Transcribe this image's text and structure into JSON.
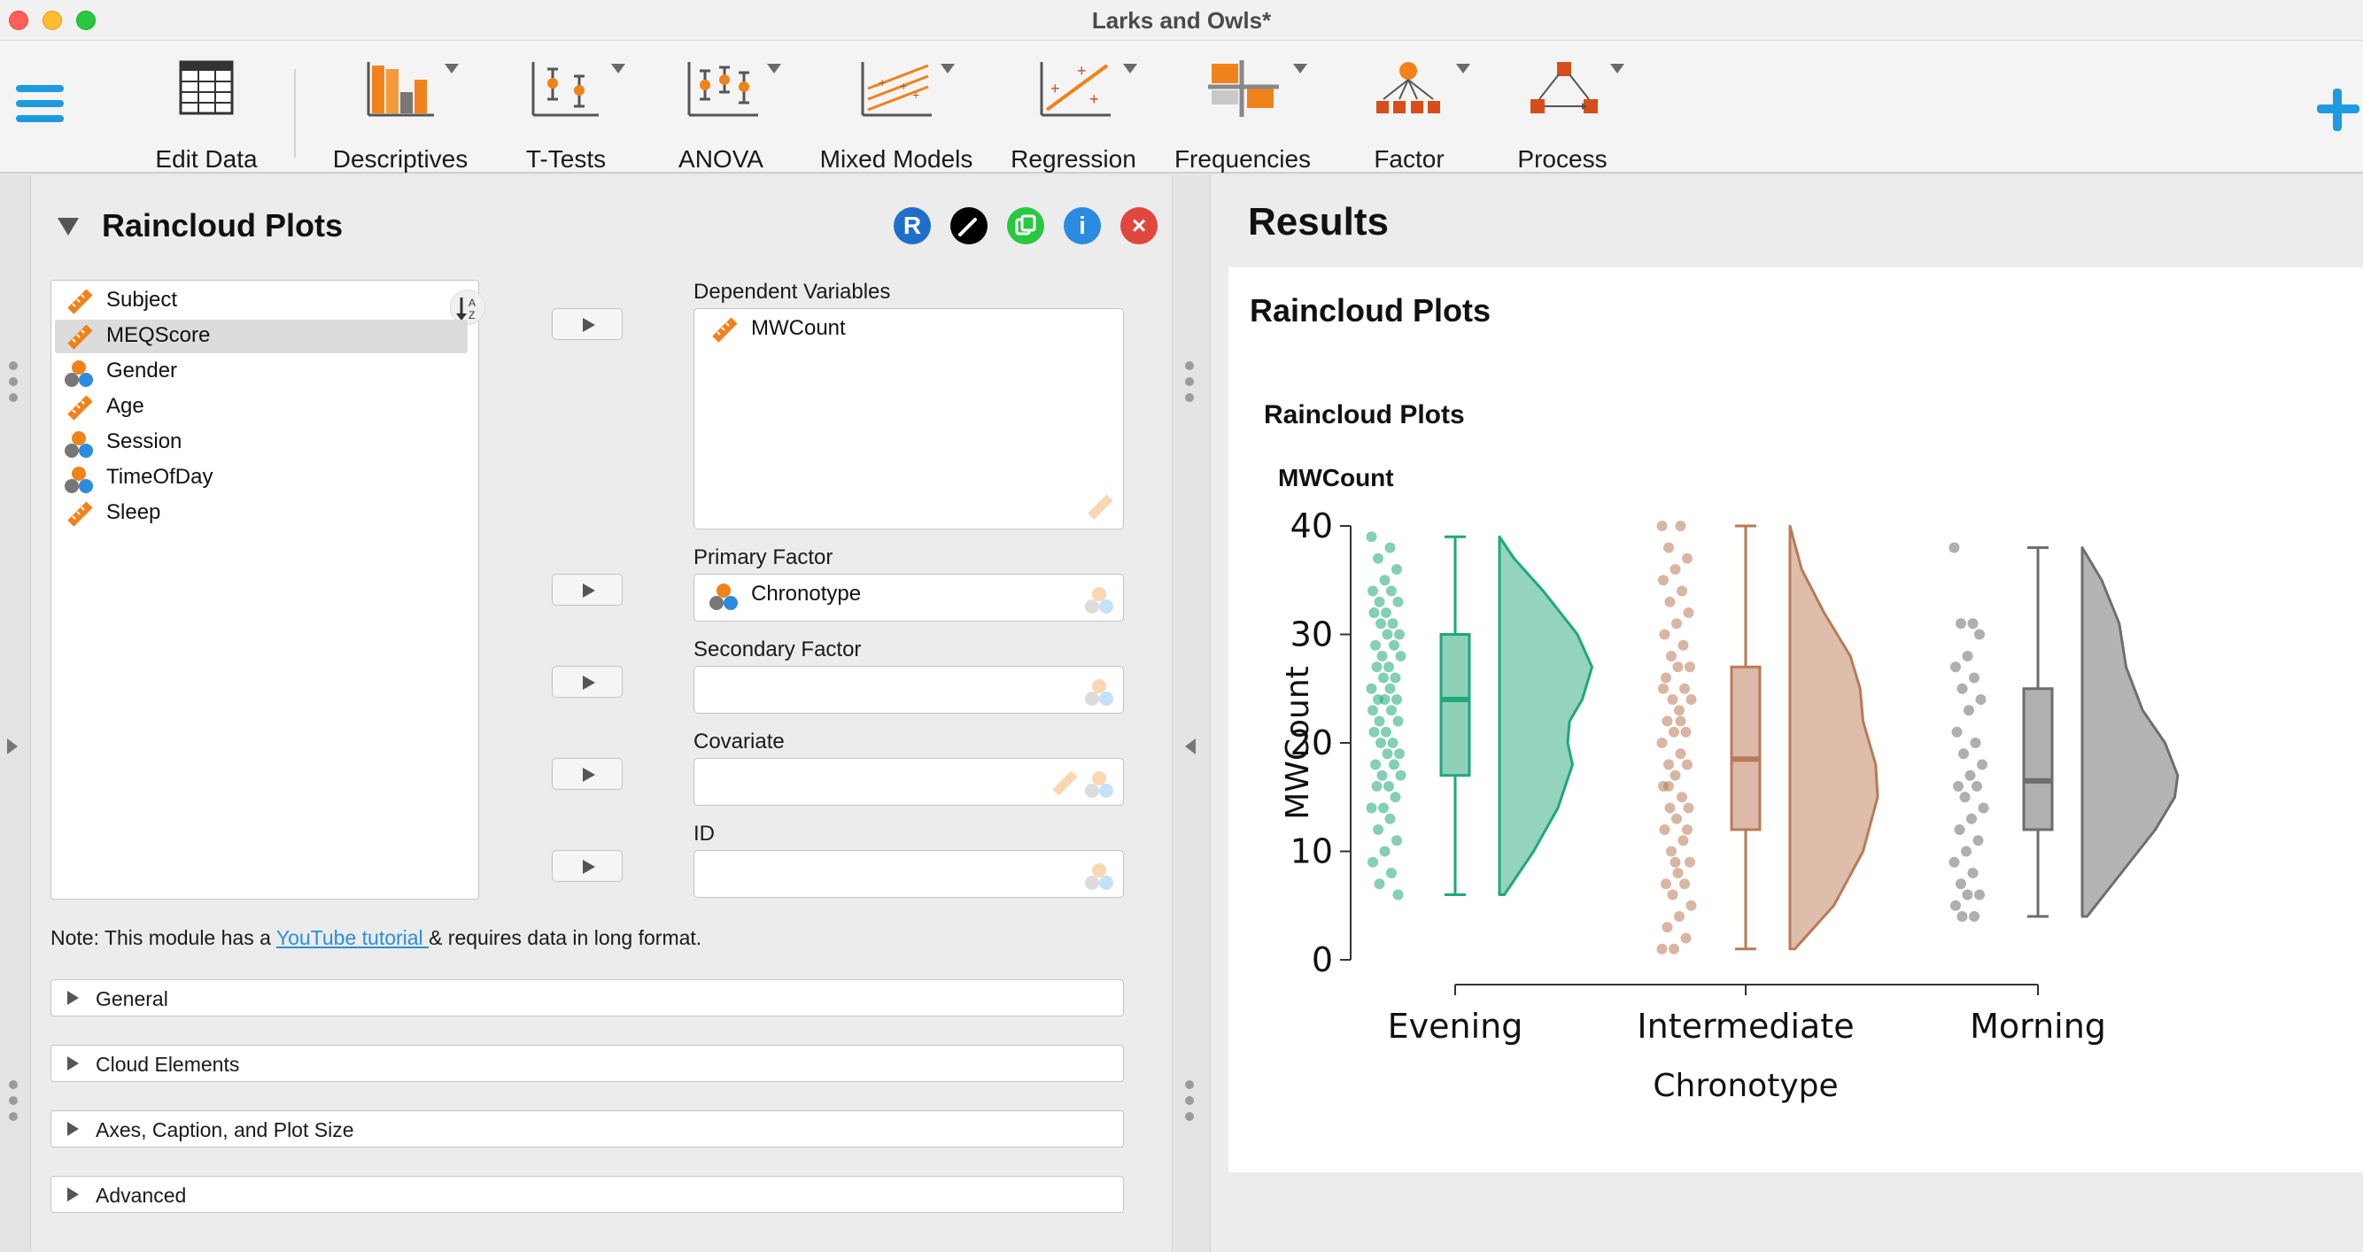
{
  "window": {
    "title": "Larks and Owls*"
  },
  "ribbon": {
    "items": [
      {
        "label": "Edit Data",
        "icon": "spreadsheet-icon",
        "menu": false
      },
      {
        "label": "Descriptives",
        "icon": "bar-chart-icon",
        "menu": true
      },
      {
        "label": "T-Tests",
        "icon": "t-test-icon",
        "menu": true
      },
      {
        "label": "ANOVA",
        "icon": "anova-icon",
        "menu": true
      },
      {
        "label": "Mixed Models",
        "icon": "mixed-models-icon",
        "menu": true
      },
      {
        "label": "Regression",
        "icon": "regression-icon",
        "menu": true
      },
      {
        "label": "Frequencies",
        "icon": "frequencies-icon",
        "menu": true
      },
      {
        "label": "Factor",
        "icon": "factor-icon",
        "menu": true
      },
      {
        "label": "Process",
        "icon": "process-icon",
        "menu": true
      }
    ]
  },
  "analysis": {
    "title": "Raincloud Plots",
    "header_icons": [
      {
        "name": "r-syntax-icon",
        "glyph": "R",
        "color": "#1f6fc9"
      },
      {
        "name": "edit-title-icon",
        "glyph": "",
        "color": "#000000"
      },
      {
        "name": "duplicate-icon",
        "glyph": "",
        "color": "#28c840"
      },
      {
        "name": "info-icon",
        "glyph": "i",
        "color": "#2a8be0"
      },
      {
        "name": "close-icon",
        "glyph": "×",
        "color": "#e0483e"
      }
    ],
    "variables": [
      {
        "name": "Subject",
        "type": "scale",
        "selected": false
      },
      {
        "name": "MEQScore",
        "type": "scale",
        "selected": true
      },
      {
        "name": "Gender",
        "type": "nominal",
        "selected": false
      },
      {
        "name": "Age",
        "type": "scale",
        "selected": false
      },
      {
        "name": "Session",
        "type": "nominal",
        "selected": false
      },
      {
        "name": "TimeOfDay",
        "type": "nominal",
        "selected": false
      },
      {
        "name": "Sleep",
        "type": "scale",
        "selected": false
      }
    ],
    "fields": {
      "dependent": {
        "label": "Dependent Variables",
        "value": "MWCount"
      },
      "primary": {
        "label": "Primary Factor",
        "value": "Chronotype"
      },
      "secondary": {
        "label": "Secondary Factor",
        "value": ""
      },
      "covariate": {
        "label": "Covariate",
        "value": ""
      },
      "id": {
        "label": "ID",
        "value": ""
      }
    },
    "note": {
      "prefix": "Note: This module has a ",
      "link": "YouTube tutorial ",
      "suffix": "& requires data in long format."
    },
    "sections": [
      "General",
      "Cloud Elements",
      "Axes, Caption, and Plot Size",
      "Advanced"
    ]
  },
  "results": {
    "title": "Results",
    "card_title": "Raincloud Plots",
    "plot_title": "Raincloud Plots",
    "plot_variable": "MWCount"
  },
  "chart_data": {
    "type": "raincloud",
    "xlabel": "Chronotype",
    "ylabel": "MWCount",
    "ylim": [
      0,
      40
    ],
    "yticks": [
      0,
      10,
      20,
      30,
      40
    ],
    "categories": [
      "Evening",
      "Intermediate",
      "Morning"
    ],
    "colors": [
      "#1fa87c",
      "#b97a58",
      "#6e6e6e"
    ],
    "fill_colors": [
      "#8ed1b8",
      "#dcbaa7",
      "#b0b0b0"
    ],
    "boxplots": [
      {
        "min": 6,
        "q1": 17,
        "median": 24,
        "q3": 30,
        "max": 39
      },
      {
        "min": 1,
        "q1": 12,
        "median": 18.5,
        "q3": 27,
        "max": 40
      },
      {
        "min": 4,
        "q1": 12,
        "median": 16.5,
        "q3": 25,
        "max": 38
      }
    ],
    "density": [
      {
        "y": [
          6,
          10,
          14,
          18,
          20,
          22,
          24,
          27,
          30,
          34,
          37,
          39
        ],
        "d": [
          0.05,
          0.35,
          0.6,
          0.75,
          0.7,
          0.72,
          0.85,
          0.95,
          0.8,
          0.45,
          0.15,
          0.0
        ]
      },
      {
        "y": [
          1,
          5,
          10,
          15,
          18,
          22,
          25,
          28,
          32,
          36,
          40
        ],
        "d": [
          0.05,
          0.45,
          0.75,
          0.9,
          0.88,
          0.75,
          0.72,
          0.62,
          0.35,
          0.12,
          0.0
        ]
      },
      {
        "y": [
          4,
          8,
          12,
          15,
          17,
          20,
          23,
          27,
          31,
          35,
          38
        ],
        "d": [
          0.05,
          0.4,
          0.75,
          0.95,
          0.98,
          0.85,
          0.62,
          0.45,
          0.38,
          0.2,
          0.0
        ]
      }
    ],
    "points": [
      [
        39,
        38,
        37,
        36,
        35,
        34,
        34,
        33,
        33,
        32,
        32,
        31,
        31,
        30,
        30,
        29,
        29,
        28,
        28,
        27,
        27,
        26,
        26,
        25,
        25,
        24,
        24,
        24,
        23,
        23,
        22,
        22,
        21,
        21,
        20,
        20,
        19,
        19,
        18,
        18,
        17,
        17,
        16,
        16,
        15,
        14,
        14,
        13,
        12,
        11,
        10,
        9,
        8,
        7,
        6
      ],
      [
        40,
        40,
        38,
        37,
        36,
        35,
        34,
        33,
        32,
        31,
        30,
        29,
        28,
        27,
        27,
        26,
        25,
        24,
        24,
        23,
        22,
        21,
        21,
        20,
        19,
        18,
        18,
        17,
        16,
        15,
        14,
        14,
        13,
        12,
        11,
        10,
        9,
        8,
        7,
        7,
        6,
        5,
        4,
        3,
        2,
        1,
        1,
        22,
        16,
        12,
        9,
        25
      ],
      [
        38,
        31,
        31,
        30,
        28,
        27,
        26,
        25,
        24,
        23,
        21,
        20,
        19,
        18,
        17,
        16,
        16,
        15,
        14,
        13,
        12,
        11,
        10,
        9,
        8,
        7,
        6,
        6,
        5,
        4,
        4
      ]
    ]
  }
}
